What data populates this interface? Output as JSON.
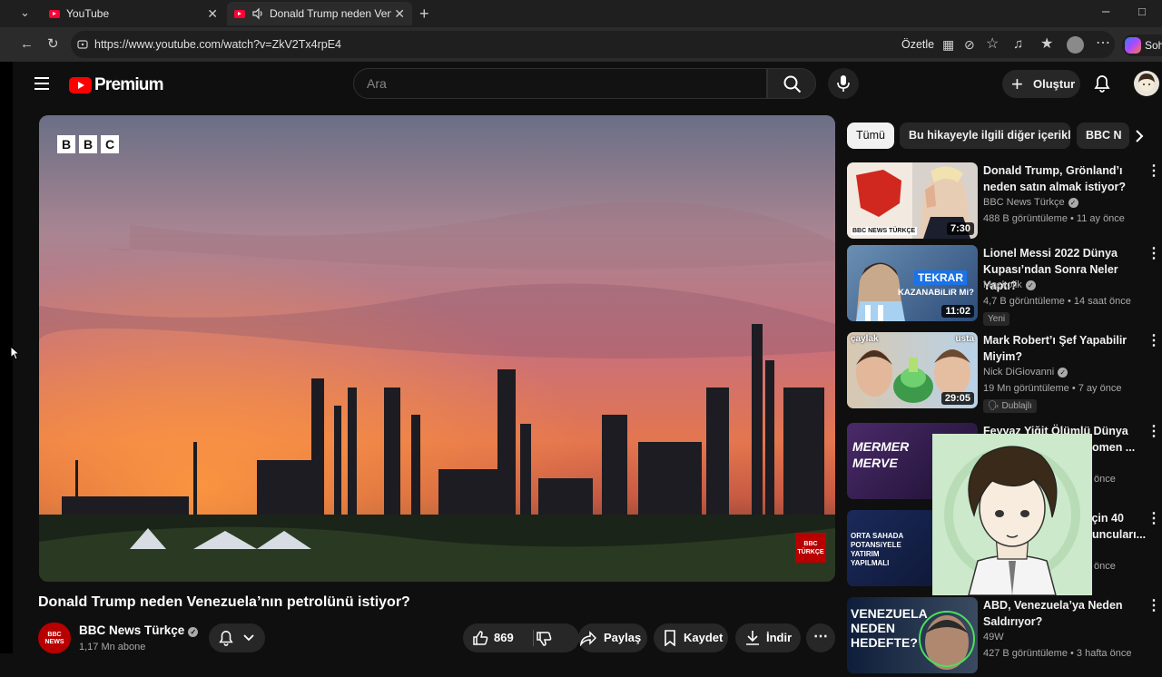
{
  "browser": {
    "tabs": [
      {
        "title": "YouTube"
      },
      {
        "title": "Donald Trump neden Venezué"
      }
    ],
    "url": "https://www.youtube.com/watch?v=ZkV2Tx4rpE4",
    "summarize_label": "Özetle",
    "copilot_label": "Soh"
  },
  "header": {
    "logo_text": "Premium",
    "search_placeholder": "Ara",
    "create_label": "Oluştur"
  },
  "video": {
    "bbc_letters": [
      "B",
      "B",
      "C"
    ],
    "watermark": "BBC TÜRKÇE",
    "title": "Donald Trump neden Venezuela’nın petrolünü istiyor?",
    "channel": "BBC News Türkçe",
    "channel_avatar_text": "BBC NEWS",
    "subscribers": "1,17 Mn abone",
    "likes": "869",
    "share_label": "Paylaş",
    "save_label": "Kaydet",
    "download_label": "İndir"
  },
  "chips": [
    "Tümü",
    "Bu hikayeyle ilgili diğer içerikler",
    "BBC N"
  ],
  "recommendations": [
    {
      "title": "Donald Trump, Grönland’ı neden satın almak istiyor?",
      "channel": "BBC News Türkçe",
      "verified": true,
      "meta": "488 B görüntüleme • 11 ay önce",
      "duration": "7:30",
      "badge": ""
    },
    {
      "title": "Lionel Messi 2022 Dünya Kupası’ndan Sonra Neler Yaptı?",
      "channel": "Mackolik",
      "verified": true,
      "meta": "4,7 B görüntüleme • 14 saat önce",
      "duration": "11:02",
      "badge": "Yeni"
    },
    {
      "title": "Mark Robert’ı Şef Yapabilir Miyim?",
      "channel": "Nick DiGiovanni",
      "verified": true,
      "meta": "19 Mn görüntüleme • 7 ay önce",
      "duration": "29:05",
      "badge": "Dublajlı"
    },
    {
      "title": "Feyyaz Yiğit Ölümlü Dünya",
      "title2": "omen ...",
      "channel": "",
      "verified": false,
      "meta": "önce",
      "duration": "",
      "badge": ""
    },
    {
      "title": "için 40",
      "title2": "uncuları...",
      "channel": "",
      "verified": false,
      "meta": "önce",
      "duration": "",
      "badge": ""
    },
    {
      "title": "ABD, Venezuela’ya Neden Saldırıyor?",
      "channel": "49W",
      "verified": false,
      "meta": "427 B görüntüleme • 3 hafta önce",
      "duration": "",
      "badge": ""
    }
  ],
  "thumb_text": {
    "bbc_news": "BBC NEWS TÜRKÇE",
    "tekrar": "TEKRAR",
    "kazanabilir": "KAZANABiLiR Mi?",
    "caylak": "çaylak",
    "usta": "usta",
    "mermer": "MERMER",
    "merve": "MERVE",
    "orta_sahada": "ORTA SAHADA POTANSiYELE YATIRIM YAPILMALI",
    "venezuela": "VENEZUELA NEDEN HEDEFTE?"
  },
  "colors": {
    "accent": "#ff0000",
    "bg": "#0f0f0f",
    "chip": "#272727"
  }
}
